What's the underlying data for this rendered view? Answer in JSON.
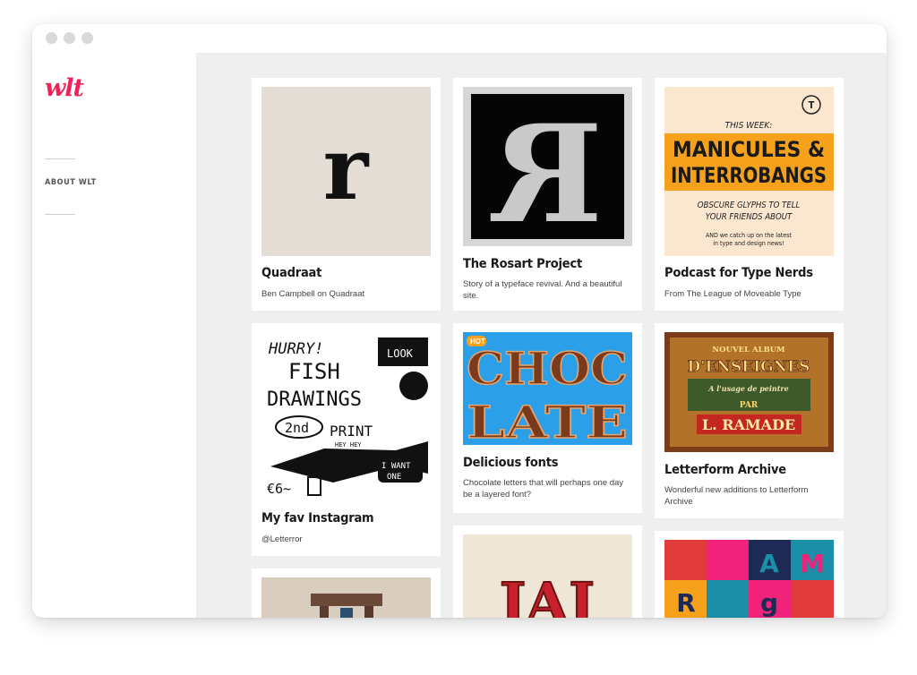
{
  "app": {
    "logo_text": "wlt",
    "brand_color": "#f0225a"
  },
  "sidebar": {
    "nav": [
      {
        "label": "ABOUT WLT"
      }
    ]
  },
  "cards": [
    {
      "title": "Quadraat",
      "desc": "Ben Campbell on Quadraat",
      "thumb_glyph": "r"
    },
    {
      "title": "The Rosart Project",
      "desc": "Story of a typeface revival. And a beautiful site.",
      "thumb_glyph": "R"
    },
    {
      "title": "Podcast for Type Nerds",
      "desc": "From The League of Moveable Type",
      "thumb_text": {
        "emblem": "T",
        "kicker": "THIS WEEK:",
        "line1": "MANICULES &",
        "line2": "INTERROBANGS",
        "sub1": "OBSCURE GLYPHS TO TELL",
        "sub2": "YOUR FRIENDS ABOUT",
        "foot1": "AND we catch up on the latest",
        "foot2": "in type and design news!"
      }
    },
    {
      "title": "My fav Instagram",
      "desc": "@Letterror",
      "thumb_text": {
        "l1": "HURRY!",
        "l2": "FISH",
        "l3": "DRAWINGS",
        "l4": "2nd",
        "l5": "PRINT",
        "l6": "HEY HEY",
        "l7": "€6~",
        "l8": "I WANT",
        "l9": "ONE",
        "l10": "LOOK"
      }
    },
    {
      "title": "Delicious fonts",
      "desc": "Chocolate letters that will perhaps one day be a layered font?",
      "thumb_text": {
        "badge": "HOT",
        "row1": "CHOC",
        "row2": "LATE"
      }
    },
    {
      "title": "Letterform Archive",
      "desc": "Wonderful new additions to Letterform Archive",
      "thumb_text": {
        "top": "NOUVEL ALBUM",
        "mid": "D'ENSEIGNES",
        "sub": "A l'usage de peintre",
        "par": "PAR",
        "name": "L. RAMADE"
      }
    },
    {
      "title": "",
      "desc": ""
    },
    {
      "title": "",
      "desc": "",
      "thumb_text": {
        "word": "JAI"
      }
    },
    {
      "title": "",
      "desc": "",
      "thumb_text": {
        "a": "A",
        "m": "M",
        "r": "R",
        "g": "g"
      }
    }
  ],
  "colors": {
    "window_bg": "#ffffff",
    "grid_bg": "#efefef",
    "podcast_orange": "#f6a11c",
    "choc_blue": "#2b9fe8",
    "choc_brown": "#7a3b1c"
  }
}
